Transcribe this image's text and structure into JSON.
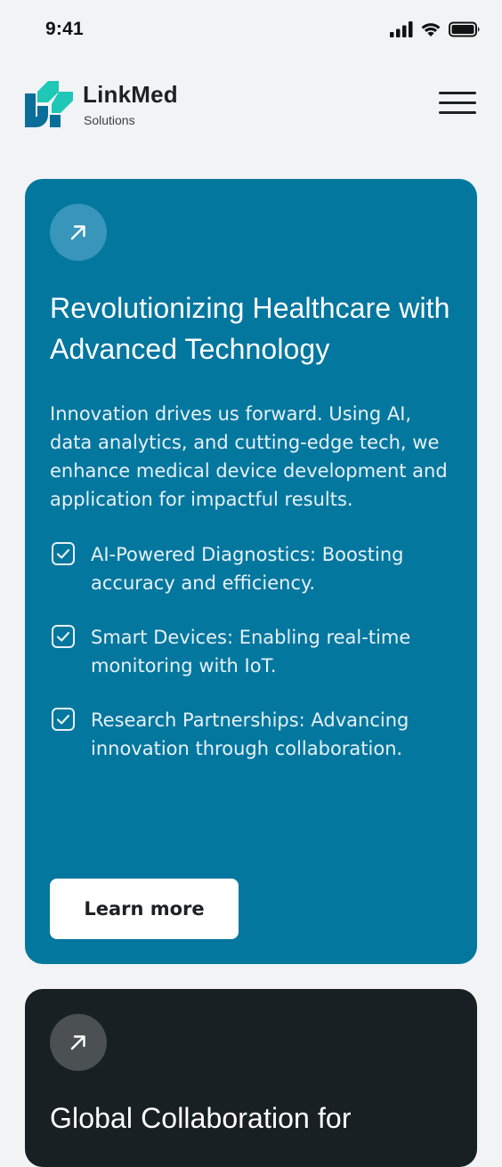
{
  "status_bar": {
    "time": "9:41",
    "icons": [
      "cellular-signal-icon",
      "wifi-icon",
      "battery-icon"
    ]
  },
  "header": {
    "brand_name": "LinkMed",
    "brand_subtitle": "Solutions",
    "logo_icon": "linkmed-logo-icon",
    "menu_icon": "hamburger-menu-icon"
  },
  "cards": [
    {
      "icon": "arrow-up-right-icon",
      "title": "Revolutionizing Healthcare with Advanced Technology",
      "description": "Innovation drives us forward. Using AI, data analytics, and cutting-edge tech, we enhance medical device development and application for impactful results.",
      "features": [
        "AI-Powered Diagnostics: Boosting accuracy and efficiency.",
        "Smart Devices: Enabling real-time monitoring with IoT.",
        "Research Partnerships: Advancing innovation through collaboration."
      ],
      "cta_label": "Learn more",
      "background_color": "#04779f"
    },
    {
      "icon": "arrow-up-right-icon",
      "title": "Global Collaboration for",
      "background_color": "#192023"
    }
  ],
  "colors": {
    "page_background": "#f1f3f5",
    "brand_teal": "#1fc7b6",
    "brand_blue": "#0a6e99",
    "text_dark": "#1b2124"
  }
}
